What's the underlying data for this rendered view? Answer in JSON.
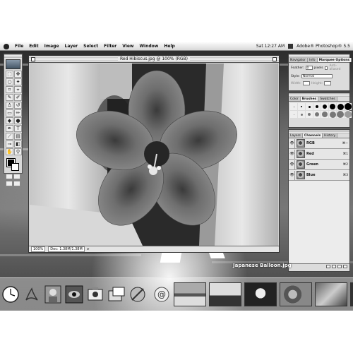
{
  "menubar": {
    "items": [
      "File",
      "Edit",
      "Image",
      "Layer",
      "Select",
      "Filter",
      "View",
      "Window",
      "Help"
    ],
    "clock": "Sat 12:27 AM",
    "app_name": "Adobe® Photoshop® 5.5"
  },
  "document": {
    "title": "Red Hibiscus.jpg @ 100% (RGB)",
    "zoom": "100%",
    "doc_size": "Doc: 1.38M/1.38M"
  },
  "palettes": {
    "navigator_tabs": [
      "Navigator",
      "Info",
      "Marquee Options"
    ],
    "feather_label": "Feather:",
    "feather_value": "0",
    "feather_unit": "pixels",
    "anti_aliased_label": "Anti-aliased",
    "style_label": "Style:",
    "style_value": "Normal",
    "width_label": "Width:",
    "height_label": "Height:",
    "brush_tabs": [
      "Color",
      "Brushes",
      "Swatches"
    ],
    "channel_tabs": [
      "Layers",
      "Channels",
      "History"
    ],
    "channels": [
      {
        "name": "RGB",
        "shortcut": "⌘~"
      },
      {
        "name": "Red",
        "shortcut": "⌘1"
      },
      {
        "name": "Green",
        "shortcut": "⌘2"
      },
      {
        "name": "Blue",
        "shortcut": "⌘3"
      }
    ]
  },
  "desktop": {
    "balloon_label": "Japanese Balloon.jpg"
  },
  "dock": {
    "apps": [
      "clock-icon",
      "acrobat-icon",
      "portrait-icon",
      "photoshop-icon",
      "iphoto-icon",
      "image-capture-icon",
      "system-prefs-icon",
      "mail-icon"
    ],
    "thumbnails": [
      "beach-photo",
      "palm-photo",
      "balloon-photo",
      "flowers-photo",
      "parrot-photo",
      "more-photo"
    ]
  }
}
